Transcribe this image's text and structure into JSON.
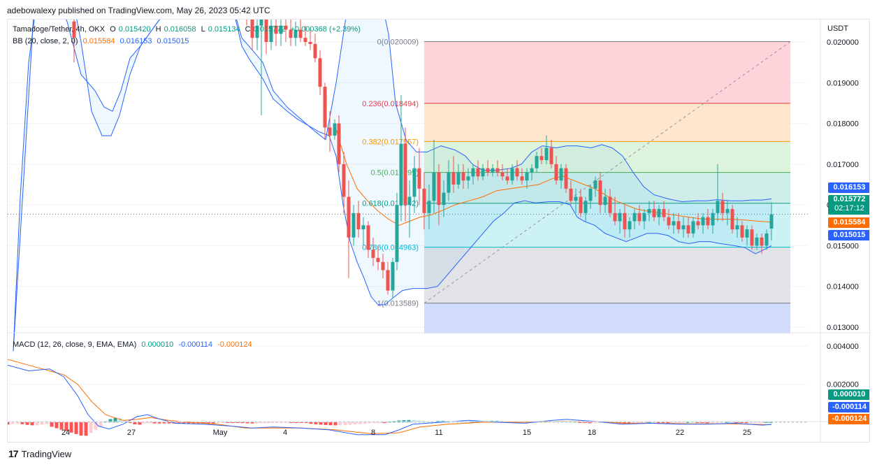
{
  "header": {
    "published_by": "adebowalexy published on TradingView.com, May 26, 2023 05:42 UTC"
  },
  "legend": {
    "symbol": "Tamadoge/Tether, 4h, OKX",
    "o_label": "O",
    "o_value": "0.015420",
    "h_label": "H",
    "h_value": "0.016058",
    "l_label": "L",
    "l_value": "0.015134",
    "c_label": "C",
    "c_value": "0.015772",
    "change": "+0.000368 (+2.39%)",
    "bb_label": "BB (20, close, 2, 0)",
    "bb_basis": "0.015584",
    "bb_upper": "0.016153",
    "bb_lower": "0.015015",
    "macd_label": "MACD (12, 26, close, 9, EMA, EMA)",
    "macd_hist": "0.000010",
    "macd_line": "-0.000114",
    "macd_signal": "-0.000124"
  },
  "price_axis": {
    "currency": "USDT",
    "ticks": [
      "0.020000",
      "0.019000",
      "0.018000",
      "0.017000",
      "0.016000",
      "0.015000",
      "0.014000",
      "0.013000"
    ]
  },
  "macd_axis": {
    "ticks": [
      "0.004000",
      "0.002000"
    ]
  },
  "time_axis": {
    "labels": [
      "24",
      "27",
      "May",
      "4",
      "8",
      "11",
      "15",
      "18",
      "22",
      "25"
    ]
  },
  "badges": {
    "bb_upper": "0.016153",
    "price": "0.015772",
    "countdown": "02:17:12",
    "bb_basis": "0.015584",
    "bb_lower": "0.015015",
    "macd_hist": "0.000010",
    "macd_line": "-0.000114",
    "macd_signal": "-0.000124"
  },
  "colors": {
    "up": "#26a69a",
    "down": "#ef5350",
    "bb_band": "#2962ff",
    "bb_basis": "#ff6d00",
    "fib_0": "#787b86",
    "fib_236": "#f23645",
    "fib_382": "#ff9800",
    "fib_5": "#4caf50",
    "fib_618": "#089981",
    "fib_786": "#00bcd4",
    "fib_1": "#787b86",
    "fib_ext": "#2962ff",
    "macd_line": "#2962ff",
    "signal_line": "#ff6d00"
  },
  "chart_data": {
    "type": "candlestick",
    "title": "Tamadoge/Tether, 4h, OKX",
    "x_labels": [
      "24",
      "27",
      "May",
      "4",
      "8",
      "11",
      "15",
      "18",
      "22",
      "25"
    ],
    "ylim": [
      0.0123,
      0.0206
    ],
    "fibonacci": [
      {
        "label": "0(0.020009)",
        "ratio": 0,
        "value": 0.020009
      },
      {
        "label": "0.236(0.018494)",
        "ratio": 0.236,
        "value": 0.018494
      },
      {
        "label": "0.382(0.017557)",
        "ratio": 0.382,
        "value": 0.017557
      },
      {
        "label": "0.5(0.016799)",
        "ratio": 0.5,
        "value": 0.016799
      },
      {
        "label": "0.618(0.016042)",
        "ratio": 0.618,
        "value": 0.016042
      },
      {
        "label": "0.786(0.014963)",
        "ratio": 0.786,
        "value": 0.014963
      },
      {
        "label": "1(0.013589)",
        "ratio": 1,
        "value": 0.013589
      }
    ],
    "last": {
      "open": 0.01542,
      "high": 0.016058,
      "low": 0.015134,
      "close": 0.015772
    },
    "bollinger": {
      "basis": 0.015584,
      "upper": 0.016153,
      "lower": 0.015015
    },
    "macd": {
      "histogram": 1e-05,
      "macd": -0.000114,
      "signal": -0.000124
    },
    "macd_ylim": [
      -0.0011,
      0.0047
    ]
  }
}
